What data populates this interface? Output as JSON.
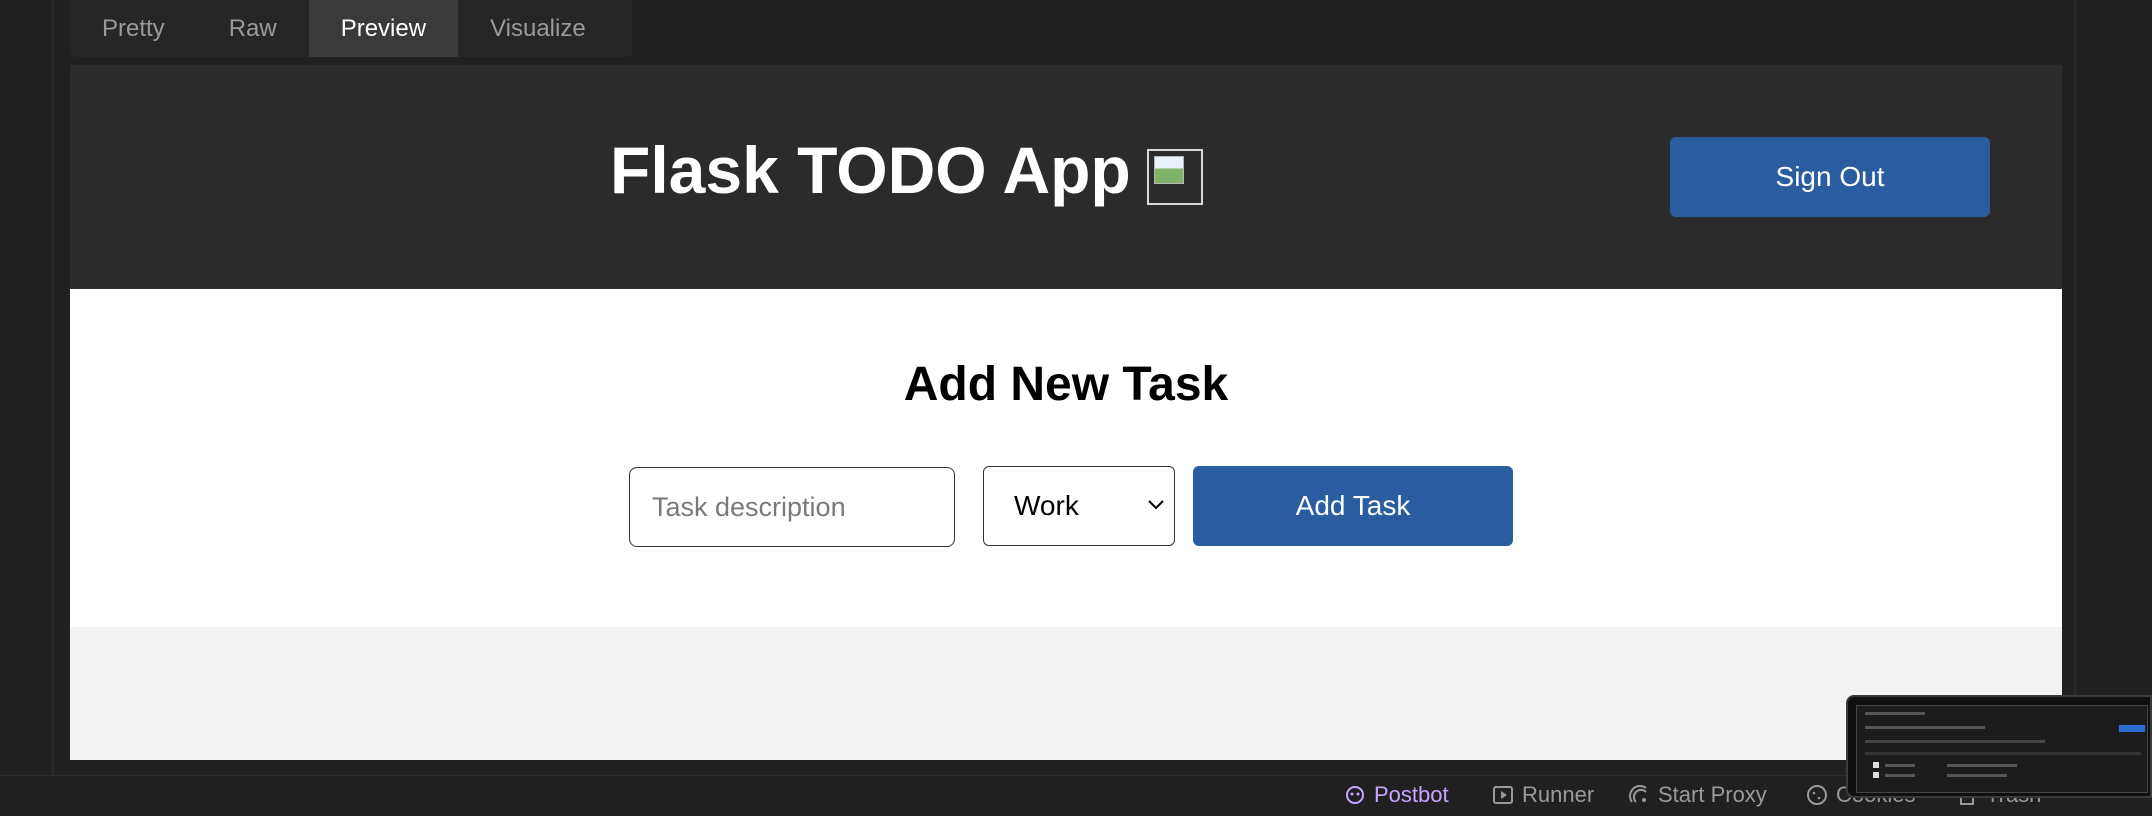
{
  "tabs": [
    {
      "label": "Pretty",
      "active": false
    },
    {
      "label": "Raw",
      "active": false
    },
    {
      "label": "Preview",
      "active": true
    },
    {
      "label": "Visualize",
      "active": false
    }
  ],
  "preview": {
    "site_title": "Flask TODO App",
    "signout_label": "Sign Out",
    "add_title": "Add New Task",
    "task_placeholder": "Task description",
    "task_value": "",
    "category_selected": "Work",
    "add_button_label": "Add Task"
  },
  "statusbar": {
    "postbot": "Postbot",
    "runner": "Runner",
    "start_proxy": "Start Proxy",
    "cookies": "Cookies",
    "trash": "Trash"
  },
  "colors": {
    "accent_blue": "#2a5d9f",
    "header_bg": "#2b2b2b",
    "app_bg": "#202020",
    "postbot_purple": "#c9a5ff"
  },
  "icons": [
    "image-placeholder-icon",
    "chevron-down-icon",
    "postbot-icon",
    "runner-icon",
    "proxy-icon",
    "cookie-icon",
    "trash-icon"
  ]
}
